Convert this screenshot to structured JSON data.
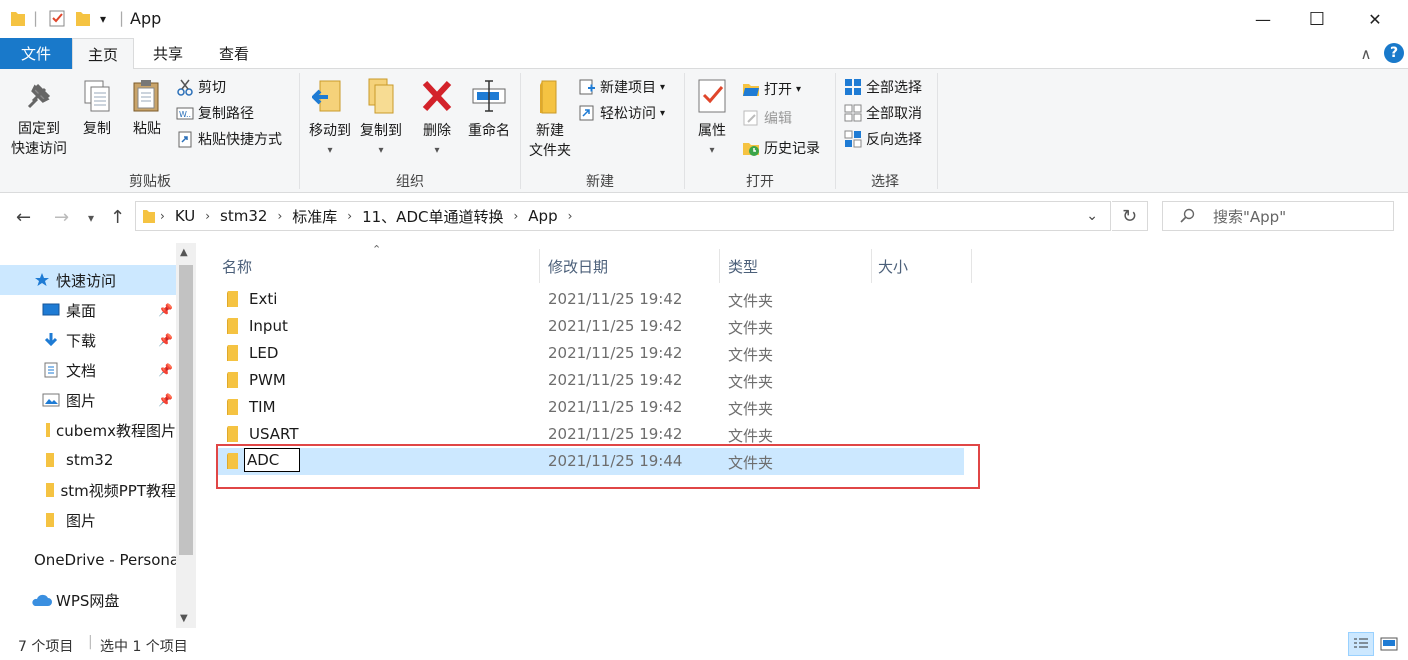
{
  "window": {
    "title": "App",
    "qa_dropdown": "▾"
  },
  "window_controls": {
    "minimize": "—",
    "maximize": "☐",
    "close": "✕"
  },
  "tabs": [
    {
      "label": "文件"
    },
    {
      "label": "主页"
    },
    {
      "label": "共享"
    },
    {
      "label": "查看"
    }
  ],
  "ribbon_extra": {
    "collapse": "∧",
    "help": "?"
  },
  "ribbon": {
    "clipboard": {
      "pin_label_1": "固定到",
      "pin_label_2": "快速访问",
      "copy": "复制",
      "paste": "粘贴",
      "cut": "剪切",
      "copy_path": "复制路径",
      "paste_shortcut": "粘贴快捷方式",
      "group": "剪贴板"
    },
    "organize": {
      "move_to": "移动到",
      "copy_to": "复制到",
      "delete": "删除",
      "rename": "重命名",
      "group": "组织"
    },
    "new": {
      "new_folder_1": "新建",
      "new_folder_2": "文件夹",
      "new_item": "新建项目",
      "easy_access": "轻松访问",
      "group": "新建"
    },
    "open": {
      "properties": "属性",
      "open": "打开",
      "edit": "编辑",
      "history": "历史记录",
      "group": "打开"
    },
    "select": {
      "select_all": "全部选择",
      "select_none": "全部取消",
      "invert": "反向选择",
      "group": "选择"
    }
  },
  "address": {
    "breadcrumbs": [
      "KU",
      "stm32",
      "标准库",
      "11、ADC单通道转换",
      "App"
    ],
    "search_placeholder": "搜索\"App\""
  },
  "nav_pane": [
    {
      "label": "快速访问",
      "icon": "star-icon"
    },
    {
      "label": "桌面",
      "icon": "desktop-icon"
    },
    {
      "label": "下载",
      "icon": "download-icon"
    },
    {
      "label": "文档",
      "icon": "document-icon"
    },
    {
      "label": "图片",
      "icon": "picture-icon"
    },
    {
      "label": "cubemx教程图片",
      "icon": "folder-icon"
    },
    {
      "label": "stm32",
      "icon": "folder-icon"
    },
    {
      "label": "stm视频PPT教程",
      "icon": "folder-icon"
    },
    {
      "label": "图片",
      "icon": "folder-icon"
    },
    {
      "label": "OneDrive - Personal",
      "icon": "cloud-icon"
    },
    {
      "label": "WPS网盘",
      "icon": "cloud-icon"
    }
  ],
  "columns": {
    "name": "名称",
    "modified": "修改日期",
    "type": "类型",
    "size": "大小"
  },
  "files": [
    {
      "name": "Exti",
      "date": "2021/11/25 19:42",
      "type": "文件夹"
    },
    {
      "name": "Input",
      "date": "2021/11/25 19:42",
      "type": "文件夹"
    },
    {
      "name": "LED",
      "date": "2021/11/25 19:42",
      "type": "文件夹"
    },
    {
      "name": "PWM",
      "date": "2021/11/25 19:42",
      "type": "文件夹"
    },
    {
      "name": "TIM",
      "date": "2021/11/25 19:42",
      "type": "文件夹"
    },
    {
      "name": "USART",
      "date": "2021/11/25 19:42",
      "type": "文件夹"
    },
    {
      "name": "ADC",
      "date": "2021/11/25 19:44",
      "type": "文件夹"
    }
  ],
  "status": {
    "count": "7 个项目",
    "selected": "选中 1 个项目"
  },
  "colors": {
    "file_tab": "#1979ca",
    "selection": "#cce8ff",
    "folder": "#f5c342",
    "highlight": "#e04646"
  }
}
